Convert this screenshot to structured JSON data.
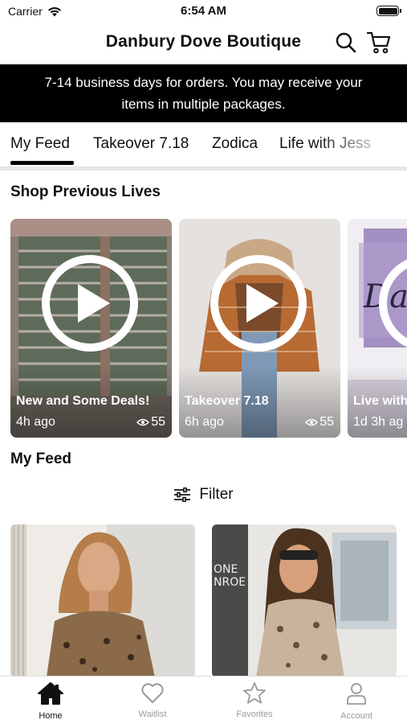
{
  "status_bar": {
    "carrier": "Carrier",
    "time": "6:54 AM"
  },
  "header": {
    "title": "Danbury Dove Boutique",
    "icons": [
      "search-icon",
      "cart-icon"
    ]
  },
  "banner": {
    "line1": "7-14 business days for orders. You may receive your",
    "line2": "items in multiple packages."
  },
  "tabs": [
    {
      "label": "My Feed",
      "selected": true
    },
    {
      "label": "Takeover 7.18"
    },
    {
      "label": "Zodica"
    },
    {
      "label": "Life with Jess"
    }
  ],
  "shop_previous_lives": {
    "title": "Shop Previous Lives",
    "items": [
      {
        "title": "New and Some Deals!",
        "ago": "4h ago",
        "views": "55"
      },
      {
        "title": "Takeover 7.18",
        "ago": "6h ago",
        "views": "55"
      },
      {
        "title": "Live with",
        "ago": "1d 3h ag",
        "views": ""
      }
    ]
  },
  "my_feed": {
    "title": "My Feed",
    "filter_label": "Filter"
  },
  "tabbar": [
    {
      "label": "Home",
      "icon": "home-icon",
      "active": true
    },
    {
      "label": "Waitlist",
      "icon": "heart-icon"
    },
    {
      "label": "Favorites",
      "icon": "star-icon"
    },
    {
      "label": "Account",
      "icon": "person-icon"
    }
  ]
}
